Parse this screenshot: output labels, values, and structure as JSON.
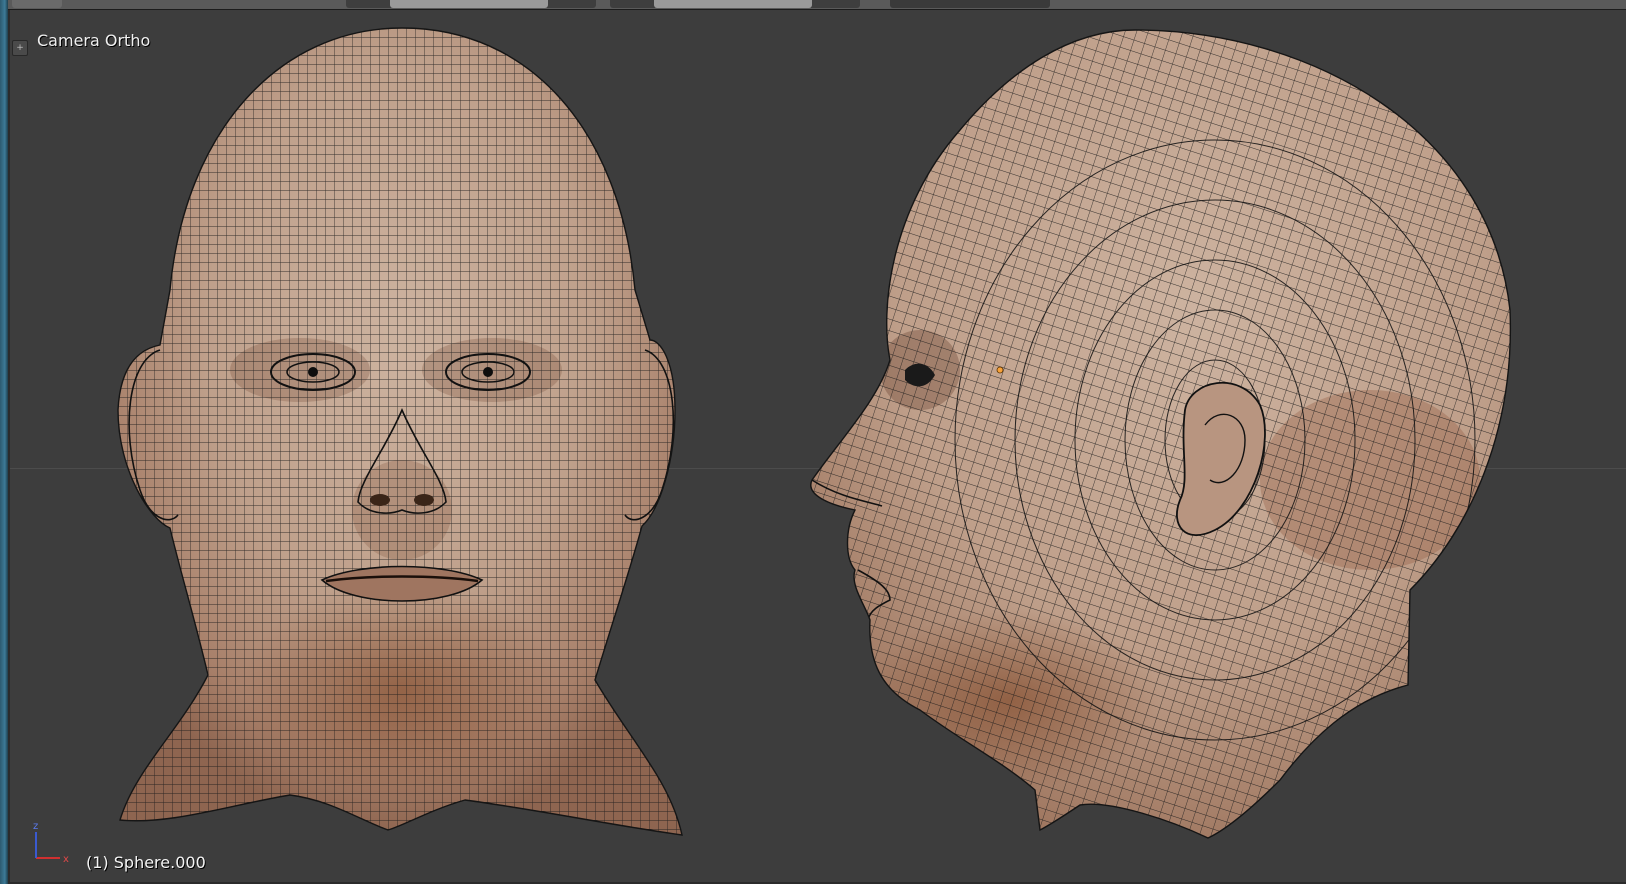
{
  "viewport": {
    "view_name": "Camera Ortho",
    "object_info": "(1) Sphere.000",
    "toggle_icon": "+",
    "axis_labels": {
      "z": "z",
      "x": "x"
    }
  },
  "colors": {
    "background": "#3d3d3d",
    "skin": "#c7ab98",
    "wire": "#1a1a1a",
    "selected_vertex": "#f7a23a",
    "axis_x": "#d03030",
    "axis_z": "#3a5ad0"
  }
}
